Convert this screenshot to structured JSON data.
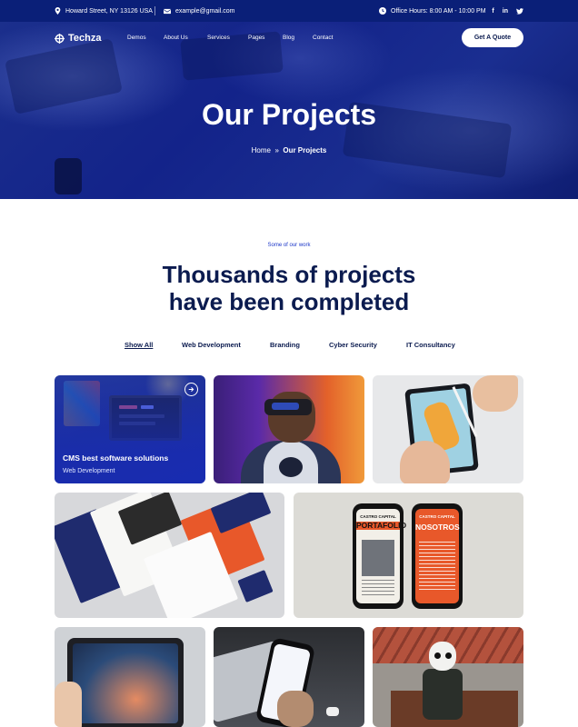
{
  "topbar": {
    "address": "Howard Street, NY 13126 USA",
    "email": "example@gmail.com",
    "hours": "Office Hours: 8:00 AM - 10:00 PM",
    "social": [
      "f",
      "in",
      "✔"
    ]
  },
  "nav": {
    "brand": "Techza",
    "items": [
      "Demos",
      "About Us",
      "Services",
      "Pages",
      "Blog",
      "Contact"
    ],
    "cta": "Get A Quote"
  },
  "hero": {
    "title": "Our Projects",
    "breadcrumb_home": "Home",
    "breadcrumb_sep": "»",
    "breadcrumb_current": "Our Projects"
  },
  "section": {
    "eyebrow": "Some of our work",
    "heading_line1": "Thousands of projects",
    "heading_line2": "have been completed"
  },
  "filters": [
    "Show All",
    "Web Development",
    "Branding",
    "Cyber Security",
    "IT Consultancy"
  ],
  "projects": [
    {
      "title": "CMS best software solutions",
      "category": "Web Development"
    }
  ],
  "mockup_text": {
    "brand_left": "CASTRO CAPITAL",
    "brand_right": "CASTRO CAPITAL",
    "word_left": "PORTAFOLIO",
    "word_right": "NOSOTROS"
  },
  "colors": {
    "primary": "#0a1f78",
    "accent": "#1b36c8",
    "heading": "#0b1b4f",
    "orange": "#e8582a"
  }
}
